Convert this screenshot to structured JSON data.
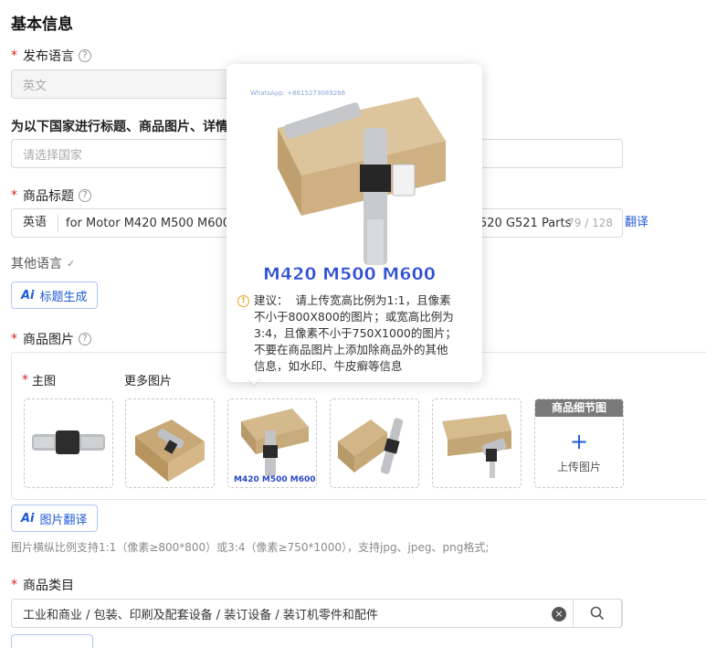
{
  "section": {
    "title": "基本信息"
  },
  "publish_language": {
    "label": "发布语言",
    "value": "英文"
  },
  "countries": {
    "label": "为以下国家进行标题、商品图片、详情",
    "placeholder": "请选择国家"
  },
  "product_title": {
    "label": "商品标题",
    "lang": "英语",
    "value_left": "for Motor M420 M500 M600",
    "value_right": "520 G521 Parts",
    "counter": "79 / 128",
    "translate": "翻译"
  },
  "other_languages": {
    "label": "其他语言"
  },
  "title_gen": {
    "ai": "Ai",
    "label": "标题生成"
  },
  "product_images": {
    "label": "商品图片",
    "main_label": "主图",
    "more_label": "更多图片",
    "detail_header": "商品细节图",
    "upload_label": "上传图片",
    "plus": "+"
  },
  "image_translate": {
    "ai": "Ai",
    "label": "图片翻译"
  },
  "image_hint": "图片横纵比例支持1:1（像素≥800*800）或3:4（像素≥750*1000），支持jpg、jpeg、png格式;",
  "category": {
    "label": "商品类目",
    "value": "工业和商业 / 包装、印刷及配套设备 / 装订设备 / 装订机零件和配件"
  },
  "popover": {
    "watermark": "WhatsApp: +8615273089266",
    "image_caption": "M420 M500 M600",
    "tip_prefix": "建议：",
    "tip_lines": [
      "请上传宽高比例为1:1，且像素",
      "不小于800X800的图片；或宽高比例为",
      "3:4，且像素不小于750X1000的图片；",
      "不要在商品图片上添加除商品外的其他",
      "信息，如水印、牛皮癣等信息"
    ]
  },
  "thumb_caption": "M420 M500 M600",
  "icons": {
    "help": "question-circle-icon",
    "info": "info-circle-icon",
    "clear": "close-circle-icon",
    "search": "search-icon",
    "edit": "pencil-icon"
  },
  "colors": {
    "accent": "#1f5bd6",
    "required": "#e02020",
    "warning": "#f0a020"
  }
}
